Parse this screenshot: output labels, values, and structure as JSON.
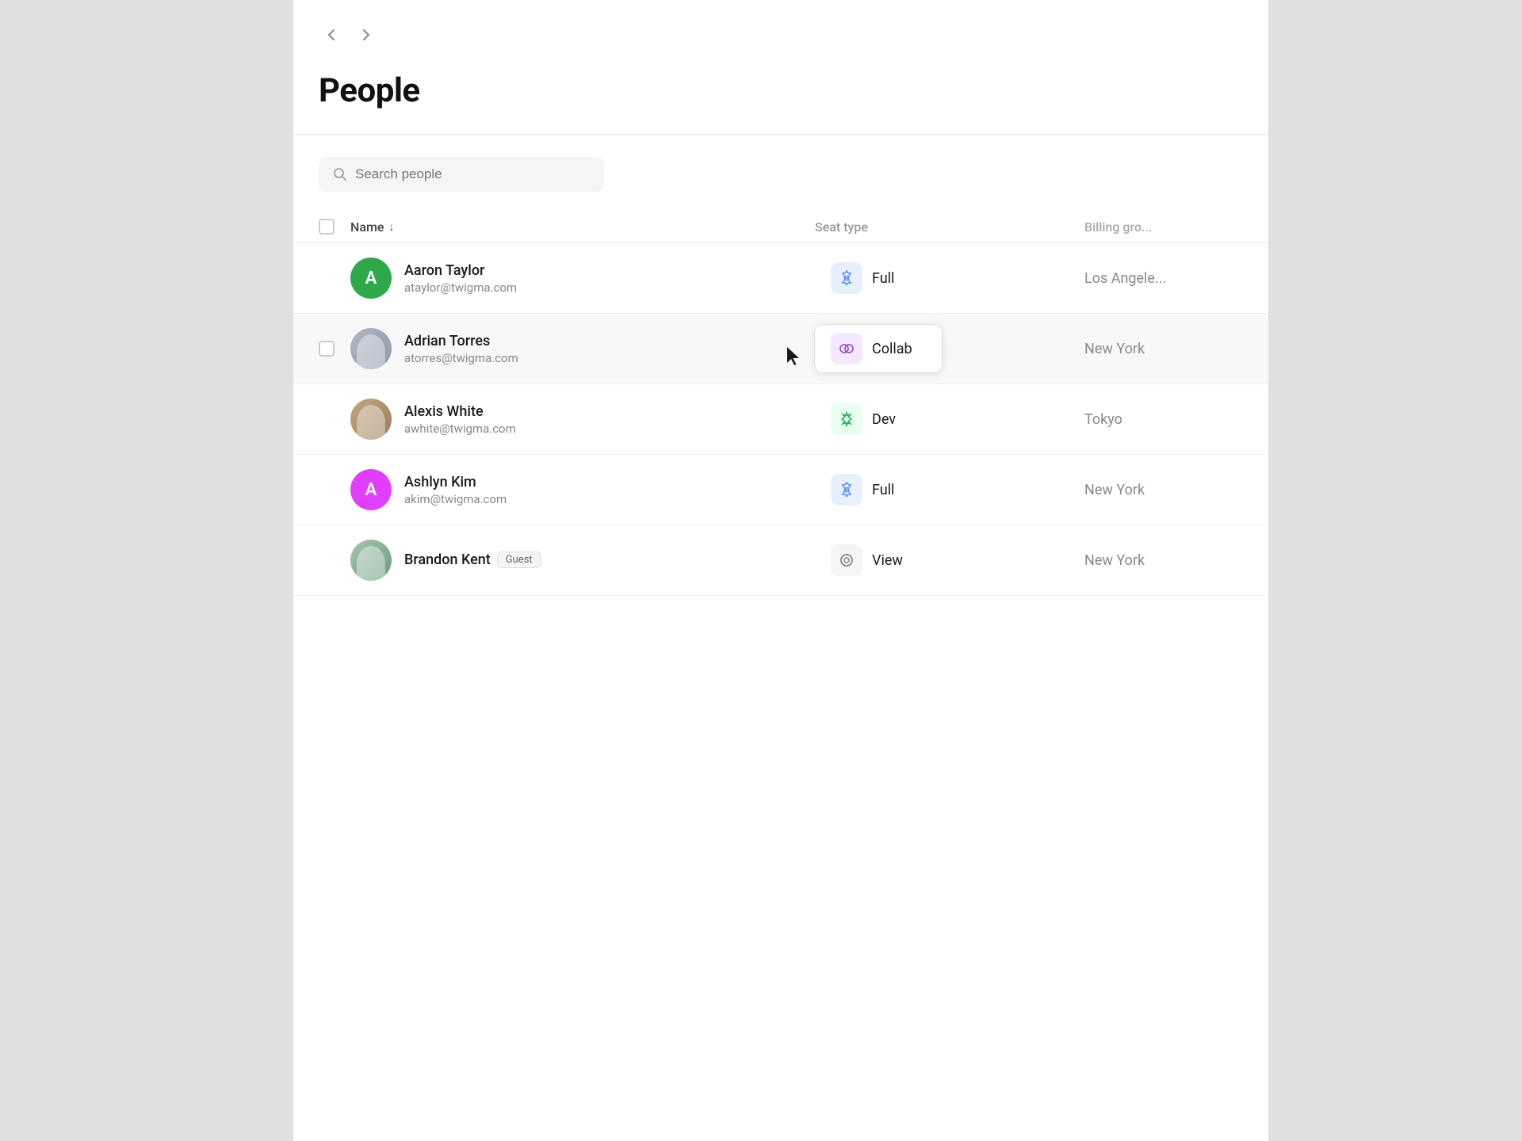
{
  "page": {
    "title": "People",
    "back_label": "‹",
    "forward_label": "›"
  },
  "search": {
    "placeholder": "Search people"
  },
  "table": {
    "columns": {
      "name": "Name",
      "seat_type": "Seat type",
      "billing_group": "Billing gro..."
    },
    "rows": [
      {
        "id": "aaron-taylor",
        "name": "Aaron Taylor",
        "email": "ataylor@twigma.com",
        "avatar_type": "letter",
        "avatar_letter": "A",
        "avatar_color": "green",
        "seat_type": "Full",
        "seat_icon": "flower",
        "billing_group": "Los Angele...",
        "is_guest": false,
        "highlighted": false
      },
      {
        "id": "adrian-torres",
        "name": "Adrian Torres",
        "email": "atorres@twigma.com",
        "avatar_type": "photo",
        "avatar_style": "torres",
        "seat_type": "Collab",
        "seat_icon": "collab",
        "billing_group": "New York",
        "is_guest": false,
        "highlighted": true
      },
      {
        "id": "alexis-white",
        "name": "Alexis White",
        "email": "awhite@twigma.com",
        "avatar_type": "photo",
        "avatar_style": "white",
        "seat_type": "Dev",
        "seat_icon": "asterisk",
        "billing_group": "Tokyo",
        "is_guest": false,
        "highlighted": false
      },
      {
        "id": "ashlyn-kim",
        "name": "Ashlyn Kim",
        "email": "akim@twigma.com",
        "avatar_type": "letter",
        "avatar_letter": "A",
        "avatar_color": "pink",
        "seat_type": "Full",
        "seat_icon": "flower",
        "billing_group": "New York",
        "is_guest": false,
        "highlighted": false
      },
      {
        "id": "brandon-kent",
        "name": "Brandon Kent",
        "email": "",
        "avatar_type": "photo",
        "avatar_style": "kent",
        "seat_type": "View",
        "seat_icon": "circle",
        "billing_group": "New York",
        "is_guest": true,
        "guest_label": "Guest",
        "highlighted": false
      }
    ]
  },
  "colors": {
    "accent": "#2ea84a",
    "pink": "#e040fb",
    "flower_bg": "#e8f0fe",
    "collab_bg": "#f3e8ff",
    "dev_bg": "#e8fef0",
    "view_bg": "#f5f5f5"
  }
}
